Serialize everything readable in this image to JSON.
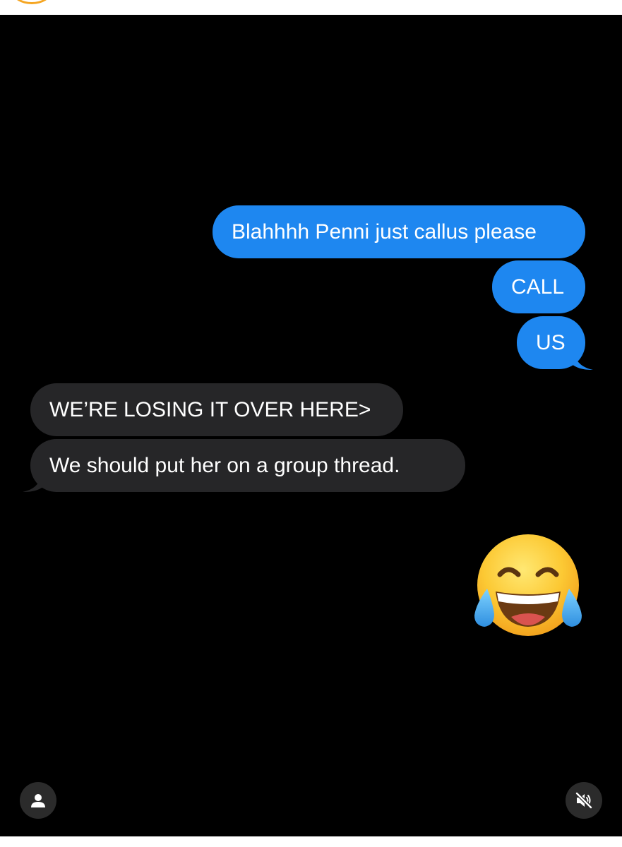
{
  "messages": [
    {
      "direction": "sent",
      "text": "Blahhhh Penni just callus please"
    },
    {
      "direction": "sent",
      "text": "CALL"
    },
    {
      "direction": "sent",
      "text": "US"
    },
    {
      "direction": "received",
      "text": "WE’RE LOSING IT OVER HERE>"
    },
    {
      "direction": "received",
      "text": "We should put her on a group thread."
    }
  ],
  "reaction_emoji": "face-with-tears-of-joy",
  "controls": {
    "profile_icon": "person-icon",
    "mute_icon": "speaker-muted-icon"
  },
  "colors": {
    "sent_bubble": "#1e87f0",
    "received_bubble": "#262628",
    "background": "#000000"
  }
}
